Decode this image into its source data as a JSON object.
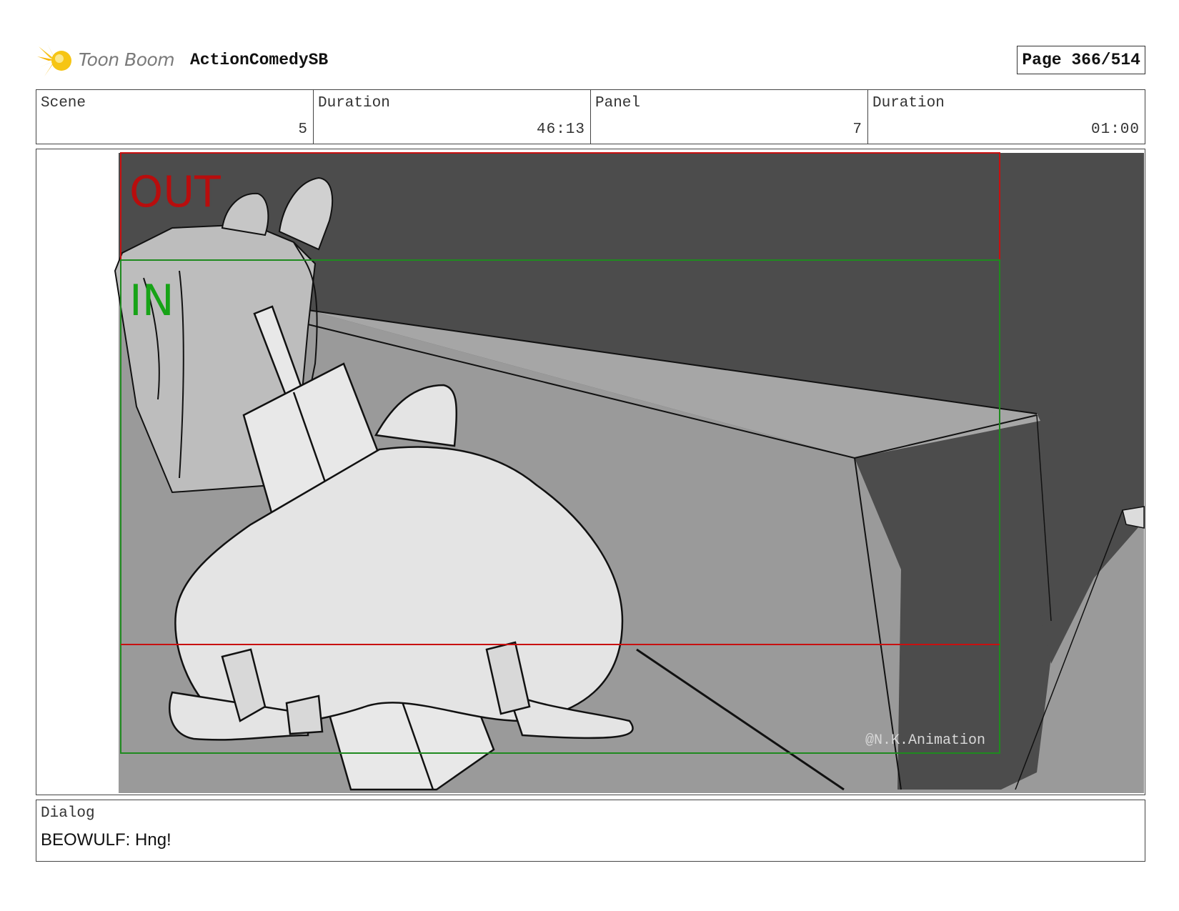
{
  "header": {
    "brand": "Toon Boom",
    "project": "ActionComedySB",
    "page": "Page 366/514"
  },
  "info": {
    "scene_label": "Scene",
    "scene_value": "5",
    "scene_duration_label": "Duration",
    "scene_duration_value": "46:13",
    "panel_label": "Panel",
    "panel_value": "7",
    "panel_duration_label": "Duration",
    "panel_duration_value": "01:00"
  },
  "panel": {
    "out_label": "OUT",
    "in_label": "IN",
    "watermark": "@N.K.Animation"
  },
  "dialog": {
    "label": "Dialog",
    "text": "BEOWULF: Hng!"
  },
  "colors": {
    "out_frame": "#c81010",
    "in_frame": "#1f8a1f",
    "logo": "#f5c21a"
  }
}
